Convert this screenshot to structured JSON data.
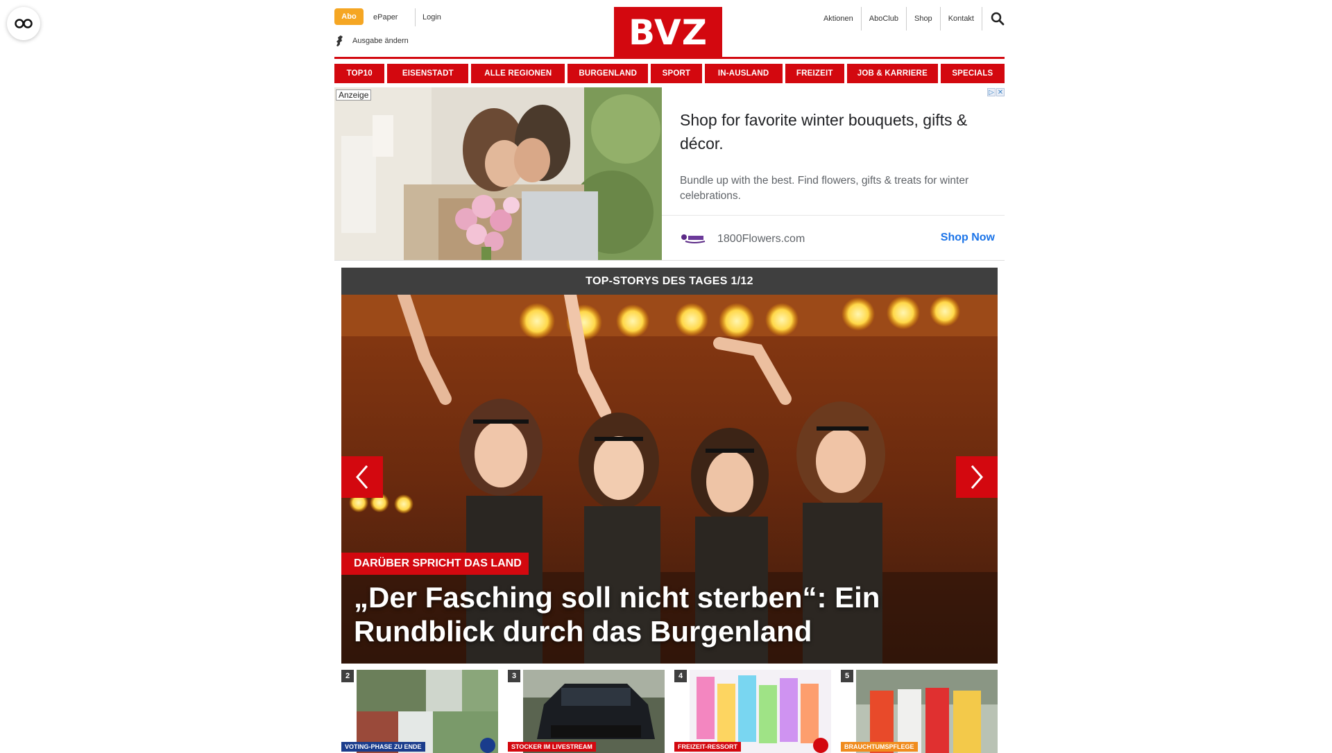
{
  "header": {
    "abo_label": "Abo",
    "epaper_label": "ePaper",
    "login_label": "Login",
    "edition_label": "Ausgabe ändern",
    "logo_text": "BVZ",
    "right_links": [
      "Aktionen",
      "AboClub",
      "Shop",
      "Kontakt"
    ]
  },
  "nav": {
    "items": [
      "TOP10",
      "EISENSTADT",
      "ALLE REGIONEN",
      "BURGENLAND",
      "SPORT",
      "IN-AUSLAND",
      "FREIZEIT",
      "JOB & KARRIERE",
      "SPECIALS"
    ]
  },
  "ad": {
    "label": "Anzeige",
    "title": "Shop for favorite winter bouquets, gifts & décor.",
    "description": "Bundle up with the best. Find flowers, gifts & treats for winter celebrations.",
    "brand": "1800Flowers.com",
    "cta": "Shop Now"
  },
  "top_stories": {
    "bar_title": "TOP-STORYS DES TAGES 1/12",
    "kicker": "DARÜBER SPRICHT DAS LAND",
    "headline": "„Der Fasching soll nicht sterben“: Ein Rundblick durch das Burgenland",
    "thumbs": [
      {
        "num": "2",
        "tag": "VOTING-PHASE ZU ENDE"
      },
      {
        "num": "3",
        "tag": "STOCKER IM LIVESTREAM"
      },
      {
        "num": "4",
        "tag": "FREIZEIT-RESSORT"
      },
      {
        "num": "5",
        "tag": "BRAUCHTUMSPFLEGE"
      }
    ]
  },
  "colors": {
    "brand_red": "#d3080f",
    "abo_orange": "#f5a623",
    "bar_dark": "#3f3f3f",
    "ad_link_blue": "#1a73e8"
  }
}
